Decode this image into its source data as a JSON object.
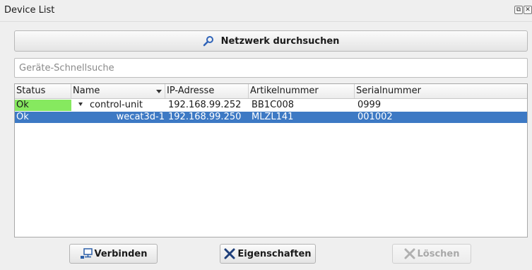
{
  "window": {
    "title": "Device List"
  },
  "titlebar_icons": [
    "restore-icon",
    "close-icon"
  ],
  "scan_button": {
    "label": "Netzwerk durchsuchen",
    "icon": "search-icon"
  },
  "search": {
    "placeholder": "Geräte-Schnellsuche",
    "value": ""
  },
  "table": {
    "columns": [
      "Status",
      "Name",
      "IP-Adresse",
      "Artikelnummer",
      "Serialnummer"
    ],
    "rows": [
      {
        "status": "Ok",
        "name": "control-unit",
        "ip": "192.168.99.252",
        "article": "BB1C008",
        "serial": "0999",
        "expanded": true,
        "selected": false
      },
      {
        "status": "Ok",
        "name": "wecat3d-1",
        "ip": "192.168.99.250",
        "article": "MLZL141",
        "serial": "001002",
        "child": true,
        "selected": true
      }
    ]
  },
  "buttons": {
    "connect": {
      "label": "Verbinden",
      "icon": "network-connect-icon"
    },
    "properties": {
      "label": "Eigenschaften",
      "icon": "tools-icon"
    },
    "delete": {
      "label": "Löschen",
      "icon": "delete-icon",
      "disabled": true
    }
  },
  "colors": {
    "status_ok": "#86e95f",
    "selection": "#3d79c4"
  }
}
